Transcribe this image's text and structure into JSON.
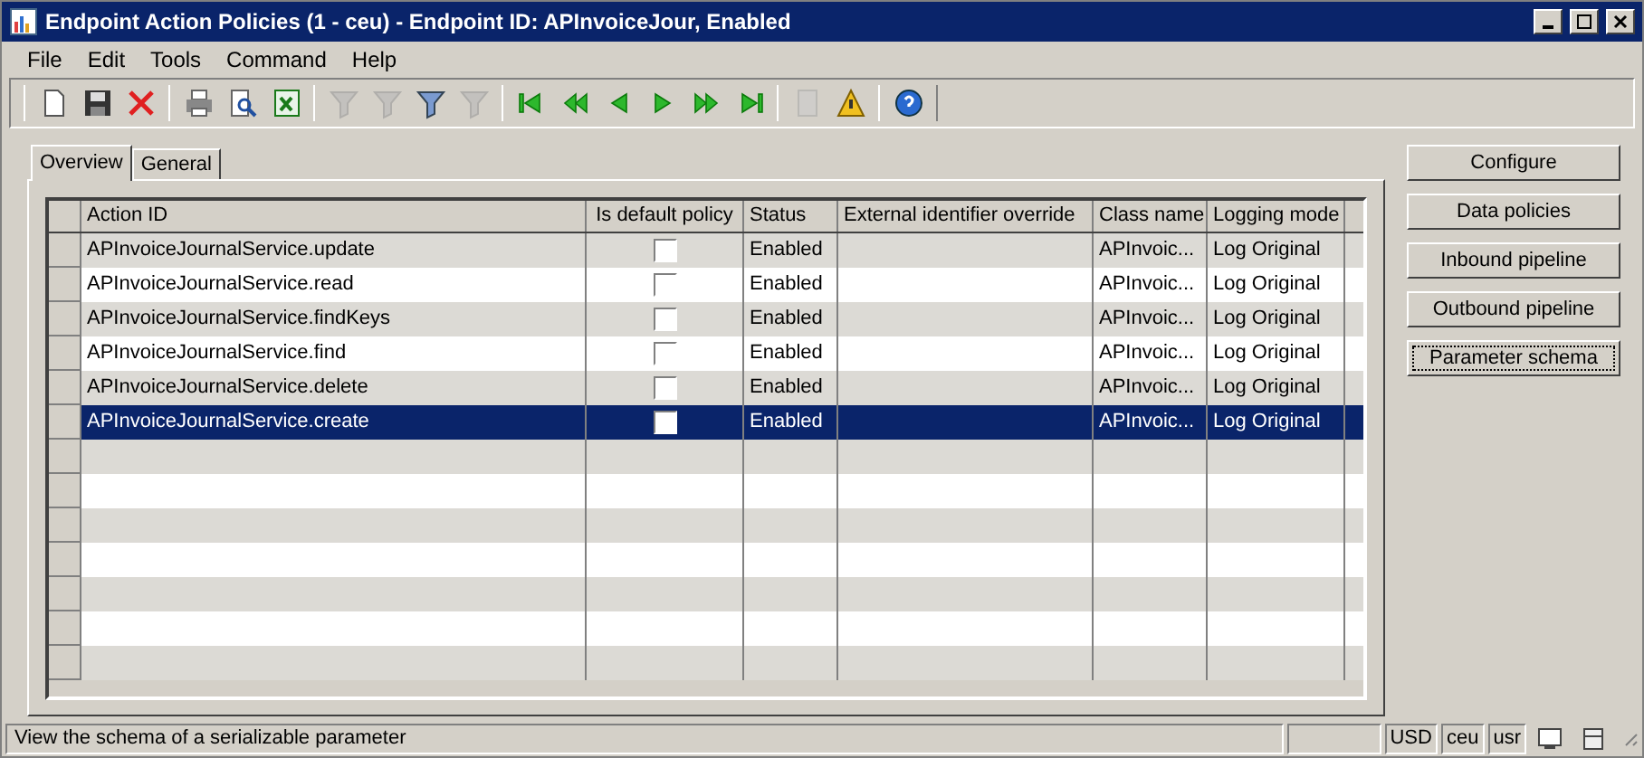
{
  "window": {
    "title": "Endpoint Action Policies (1 - ceu) - Endpoint ID: APInvoiceJour, Enabled"
  },
  "menu": [
    "File",
    "Edit",
    "Tools",
    "Command",
    "Help"
  ],
  "toolbar": [
    [
      {
        "kind": "new",
        "disabled": false
      },
      {
        "kind": "save",
        "disabled": false
      },
      {
        "kind": "delete",
        "disabled": false
      }
    ],
    [
      {
        "kind": "print",
        "disabled": false
      },
      {
        "kind": "preview",
        "disabled": false
      },
      {
        "kind": "excel",
        "disabled": false
      }
    ],
    [
      {
        "kind": "filter",
        "disabled": true
      },
      {
        "kind": "filter",
        "disabled": true
      },
      {
        "kind": "filter",
        "disabled": false
      },
      {
        "kind": "filter",
        "disabled": true
      }
    ],
    [
      {
        "kind": "first",
        "disabled": false
      },
      {
        "kind": "prev-page",
        "disabled": false
      },
      {
        "kind": "prev",
        "disabled": false
      },
      {
        "kind": "next",
        "disabled": false
      },
      {
        "kind": "next-page",
        "disabled": false
      },
      {
        "kind": "last",
        "disabled": false
      }
    ],
    [
      {
        "kind": "document",
        "disabled": true
      },
      {
        "kind": "alert",
        "disabled": false
      }
    ],
    [
      {
        "kind": "help",
        "disabled": false
      }
    ]
  ],
  "tabs": [
    {
      "label": "Overview",
      "selected": true
    },
    {
      "label": "General",
      "selected": false
    }
  ],
  "table": {
    "columns": [
      "Action ID",
      "Is default policy",
      "Status",
      "External identifier override",
      "Class name",
      "Logging mode"
    ],
    "rows": [
      {
        "action_id": "APInvoiceJournalService.update",
        "is_default": false,
        "status": "Enabled",
        "class_name": "APInvoic...",
        "logging_mode": "Log Original",
        "selected": false
      },
      {
        "action_id": "APInvoiceJournalService.read",
        "is_default": false,
        "status": "Enabled",
        "class_name": "APInvoic...",
        "logging_mode": "Log Original",
        "selected": false
      },
      {
        "action_id": "APInvoiceJournalService.findKeys",
        "is_default": false,
        "status": "Enabled",
        "class_name": "APInvoic...",
        "logging_mode": "Log Original",
        "selected": false
      },
      {
        "action_id": "APInvoiceJournalService.find",
        "is_default": false,
        "status": "Enabled",
        "class_name": "APInvoic...",
        "logging_mode": "Log Original",
        "selected": false
      },
      {
        "action_id": "APInvoiceJournalService.delete",
        "is_default": false,
        "status": "Enabled",
        "class_name": "APInvoic...",
        "logging_mode": "Log Original",
        "selected": false
      },
      {
        "action_id": "APInvoiceJournalService.create",
        "is_default": false,
        "status": "Enabled",
        "class_name": "APInvoic...",
        "logging_mode": "Log Original",
        "selected": true
      }
    ]
  },
  "buttons": [
    {
      "label": "Configure",
      "focused": false
    },
    {
      "label": "Data policies",
      "focused": false
    },
    {
      "label": "Inbound pipeline",
      "focused": false
    },
    {
      "label": "Outbound pipeline",
      "focused": false
    },
    {
      "label": "Parameter schema",
      "focused": true
    }
  ],
  "status_bar": {
    "message": "View the schema of a serializable parameter",
    "fields": [
      "USD",
      "ceu",
      "usr"
    ]
  }
}
